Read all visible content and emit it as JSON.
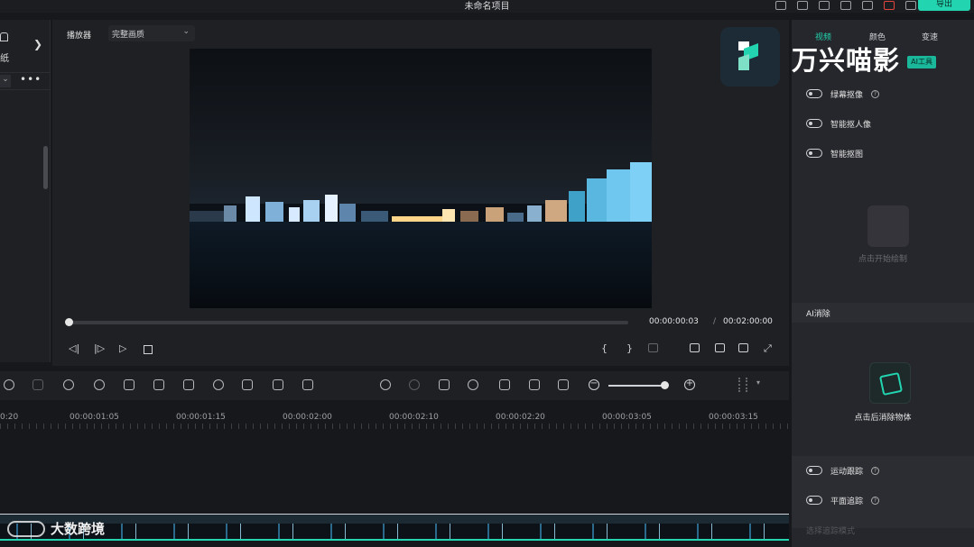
{
  "titlebar": {
    "title": "未命名项目",
    "export_label": "导出"
  },
  "left_panel": {
    "label": "纸",
    "more": "•••"
  },
  "player": {
    "label": "播放器",
    "quality": "完整画质",
    "time_current": "00:00:00:03",
    "time_separator": "/",
    "time_total": "00:02:00:00",
    "progress": 0.0
  },
  "right_panel": {
    "tabs": [
      {
        "label": "视频",
        "active": true
      },
      {
        "label": "颜色",
        "active": false
      },
      {
        "label": "变速",
        "active": false
      }
    ],
    "ai_tool_tag": "AI工具",
    "toggles_top": [
      {
        "label": "绿幕抠像",
        "help": true
      },
      {
        "label": "智能抠人像",
        "help": false
      },
      {
        "label": "智能抠图",
        "help": false
      }
    ],
    "matte_label": "点击开始绘制",
    "ai_remove_header": "AI消除",
    "remove_label": "点击后消除物体",
    "toggles_bottom": [
      {
        "label": "运动跟踪",
        "help": true
      },
      {
        "label": "平面追踪",
        "help": true
      }
    ],
    "track_mode": "选择追踪模式"
  },
  "brand": {
    "name": "万兴喵影"
  },
  "timeline": {
    "ruler": [
      "0:20",
      "00:00:01:05",
      "00:00:01:15",
      "00:00:02:00",
      "00:00:02:10",
      "00:00:02:20",
      "00:00:03:05",
      "00:00:03:15"
    ],
    "zoom_level": 0.9
  },
  "watermark": {
    "text": "大数跨境"
  },
  "colors": {
    "accent": "#22d4b0",
    "cart": "#e4463d",
    "panel": "#26272c",
    "background": "#17181c"
  }
}
